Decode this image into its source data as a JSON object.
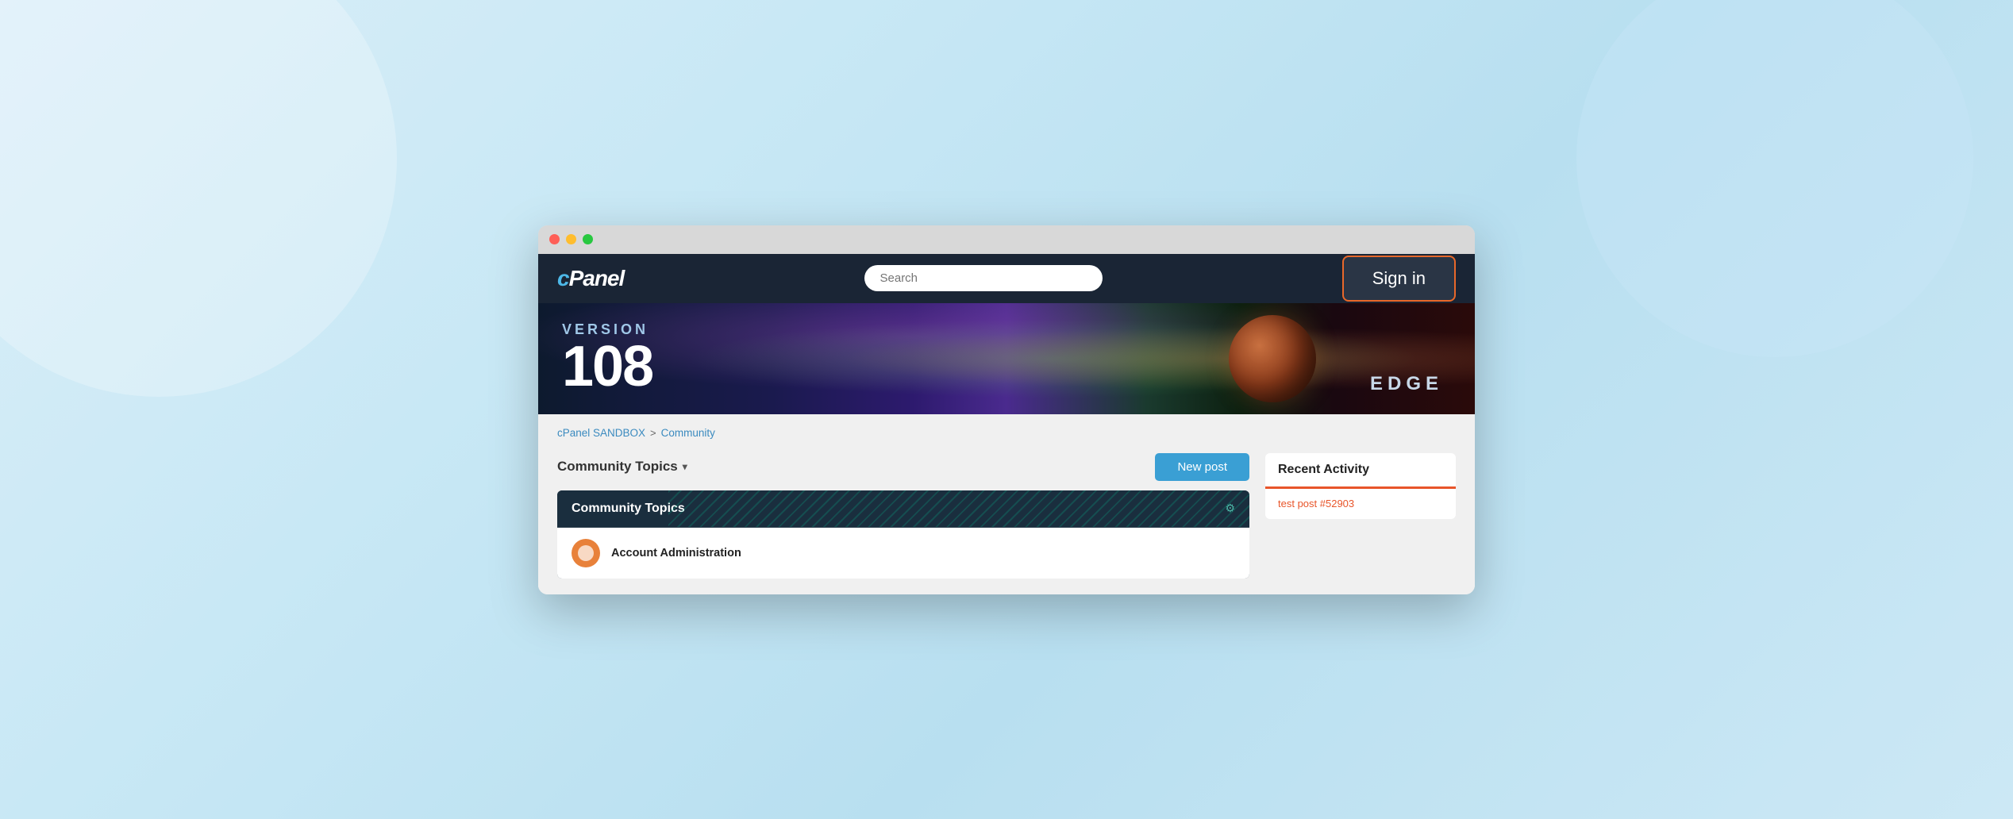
{
  "browser": {
    "traffic_lights": [
      "red",
      "yellow",
      "green"
    ]
  },
  "header": {
    "logo": "cPanel",
    "search_placeholder": "Search",
    "sign_in_label": "Sign in"
  },
  "hero": {
    "version_label": "VERSION",
    "version_number": "108",
    "edge_label": "EDGE"
  },
  "breadcrumb": {
    "items": [
      {
        "label": "cPanel SANDBOX",
        "href": "#"
      },
      {
        "label": "Community",
        "href": "#"
      }
    ],
    "separator": ">"
  },
  "main": {
    "section_title": "Community Topics",
    "section_dropdown_icon": "▾",
    "new_post_label": "New post",
    "topics_card": {
      "title": "Community Topics",
      "settings_icon": "⚙",
      "items": [
        {
          "label": "Account Administration"
        }
      ]
    }
  },
  "sidebar": {
    "recent_activity": {
      "title": "Recent Activity",
      "items": [
        {
          "label": "test post #52903"
        }
      ]
    }
  }
}
